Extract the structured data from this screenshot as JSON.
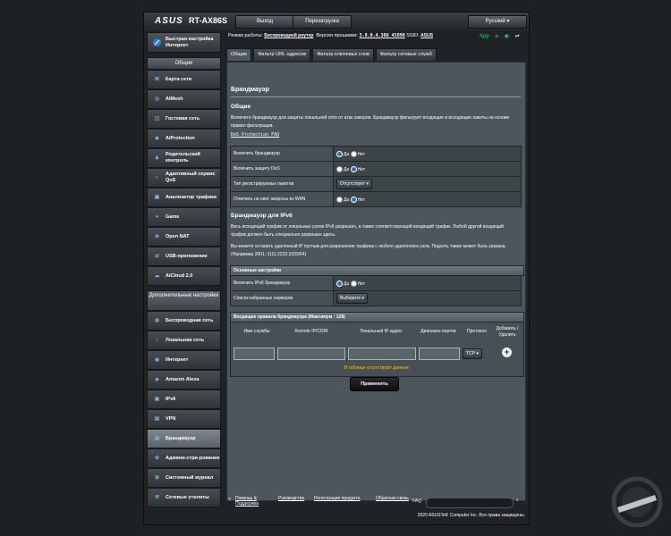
{
  "header": {
    "logo": "ASUS",
    "model": "RT-AX86S",
    "logout": "Выход",
    "reboot": "Перезагрузка",
    "language": "Русский"
  },
  "status": {
    "mode_label": "Режим работы:",
    "mode_value": "Беспроводной роутер",
    "fw_label": "Версия прошивки:",
    "fw_value": "3.0.0.4.386_45898",
    "ssid_label": "SSID:",
    "ssid_value": "ASUS",
    "app": "App"
  },
  "sidebar": {
    "qis": "Быстрая настройка Интернет",
    "general_title": "Общие",
    "general": [
      "Карта сети",
      "AiMesh",
      "Гостевая сеть",
      "AiProtection",
      "Родительский контроль",
      "Адаптивный сервис QoS",
      "Анализатор трафика",
      "Game",
      "Open NAT",
      "USB-приложение",
      "AiCloud 2.0"
    ],
    "advanced_title": "Дополнительные настройки",
    "advanced": [
      "Беспроводная сеть",
      "Локальная сеть",
      "Интернет",
      "Amazon Alexa",
      "IPv6",
      "VPN",
      "Брандмауэр",
      "Админи-стри-рование",
      "Системный журнал",
      "Сетевые утилиты"
    ]
  },
  "tabs": [
    "Общие",
    "Фильтр URL-адресов",
    "Фильтр ключевых слов",
    "Фильтр сетевых служб"
  ],
  "panel": {
    "title": "Брандмауэр",
    "general_heading": "Общие",
    "general_desc": "Включите брандмауэр для защиты локальной сети от атак хакеров. Брандмауэр фильтрует входящие и исходящие пакеты на основе правил фильтрации.",
    "dos_link": "DoS Protection FAQ",
    "rows": [
      {
        "label": "Включить брандмауэр",
        "yes": "Да",
        "no": "Нет"
      },
      {
        "label": "Включить защиту DoS",
        "yes": "Да",
        "no": "Нет"
      },
      {
        "label": "Тип регистрируемых пакетов",
        "select": "Отсутствует"
      },
      {
        "label": "Отвечать на пинг-запросы из WAN",
        "yes": "Да",
        "no": "Нет"
      }
    ],
    "ipv6_heading": "Брандмауэр для IPv6",
    "ipv6_desc1": "Весь исходящий трафик от локальных узлов IPv6 разрешен, а также соответствующий входящий трафик. Любой другой входящий трафик должен быть специально разрешен здесь.",
    "ipv6_desc2": "Вы можете оставить удаленный IP пустым для разрешения трафика с любого удаленного узла. Подсеть также может быть указана. (Например 2001::1111:2222:3333/64)",
    "basic_header": "Основные настройки",
    "ipv6_rows": [
      {
        "label": "Включить IPv6 брандмауэр",
        "yes": "Да",
        "no": "Нет"
      },
      {
        "label": "Список избранных серверов",
        "select": "Выберите"
      }
    ],
    "rules_header": "Входящие правила брандмауэра (Максимум : 128)",
    "columns": [
      "Имя службы",
      "Remote IP/CIDR",
      "Локальный IP-адрес",
      "Диапазон портов",
      "Протокол",
      "Добавить / Удалить"
    ],
    "protocol": "TCP",
    "empty": "В таблице отсутствуют данные.",
    "apply": "Применить"
  },
  "footer": {
    "help": "Помощь & Поддержка",
    "manual": "Руководство",
    "register": "Регистрация продукта",
    "feedback": "Обратная связь",
    "faq": "FAQ",
    "copyright": "2020 ASUSTeK Computer Inc. Все права защищены."
  }
}
